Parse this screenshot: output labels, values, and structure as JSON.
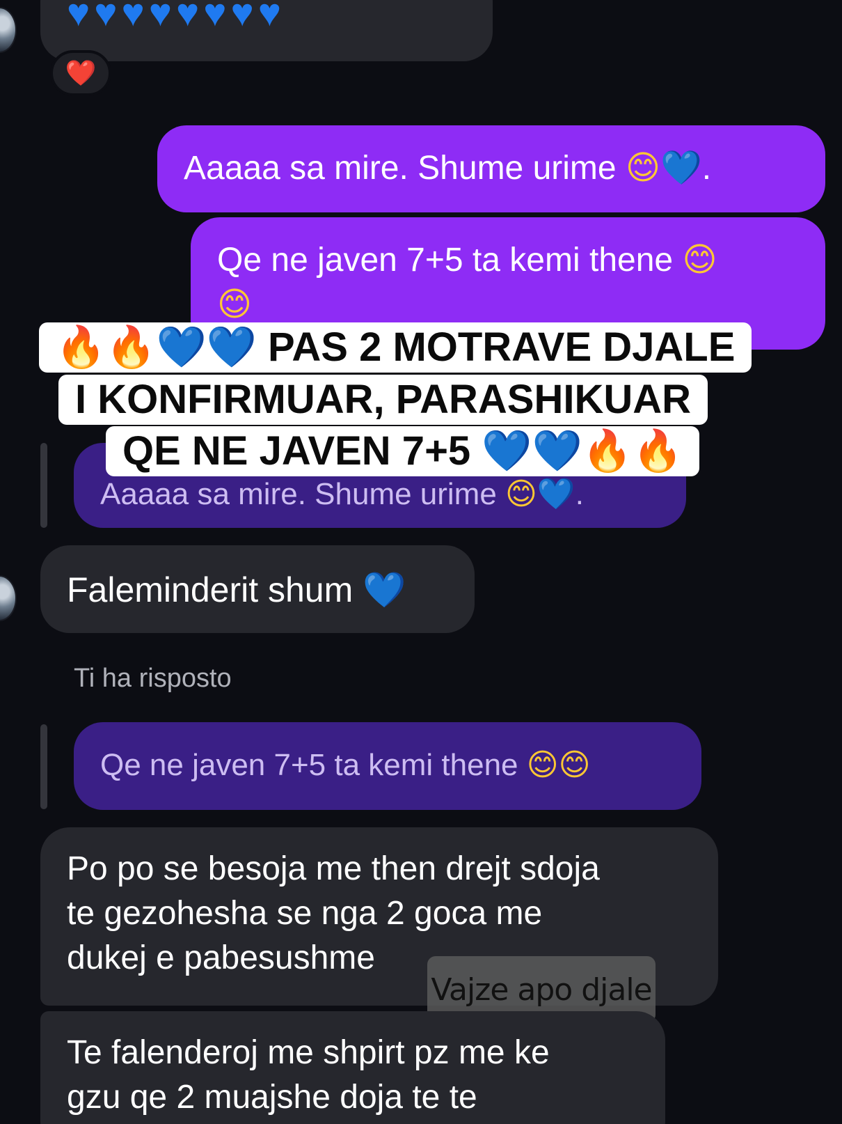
{
  "messages": {
    "heart_reaction": "❤️",
    "out_1": {
      "text": "Aaaaa sa mire. Shume urime",
      "emoji_smile": "😊",
      "emoji_heart": "💙",
      "end": "."
    },
    "out_2": {
      "text": "Qe ne javen 7+5 ta kemi thene",
      "emoji_smile": "😊"
    },
    "reply_quote_1": {
      "text": "Aaaaa sa mire. Shume urime",
      "emoji_smile": "😊",
      "emoji_heart": "💙",
      "end": "."
    },
    "in_1": {
      "text": "Faleminderit shum",
      "emoji_heart": "💙"
    },
    "reply_label": "Ti ha risposto",
    "reply_quote_2": {
      "text": "Qe ne javen 7+5 ta kemi thene",
      "emoji_smile": "😊"
    },
    "in_2": {
      "line1": "Po po se besoja me then drejt sdoja",
      "line2": "te gezohesha se nga 2 goca me",
      "line3": "dukej e pabesushme"
    },
    "in_3": {
      "line1": "Te falenderoj me shpirt pz me ke",
      "line2": "gzu qe 2 muajshe doja te te"
    }
  },
  "caption": {
    "line1_text": "PAS 2 MOTRAVE DJALE",
    "line2_text": "I KONFIRMUAR, PARASHIKUAR",
    "line3_text": "QE NE JAVEN 7+5",
    "emoji_fire": "🔥",
    "emoji_heart": "💙"
  },
  "sticker": {
    "text": "Vajze apo djale"
  },
  "colors": {
    "background": "#0c0d13",
    "incoming_bubble": "#26272d",
    "outgoing_bubble": "#8e2cf5",
    "reply_bubble": "#3a1f86",
    "caption_bg": "#ffffff"
  },
  "icons": [
    "avatar",
    "blue-heart-icon",
    "red-heart-icon",
    "smiling-face-icon",
    "fire-icon"
  ]
}
